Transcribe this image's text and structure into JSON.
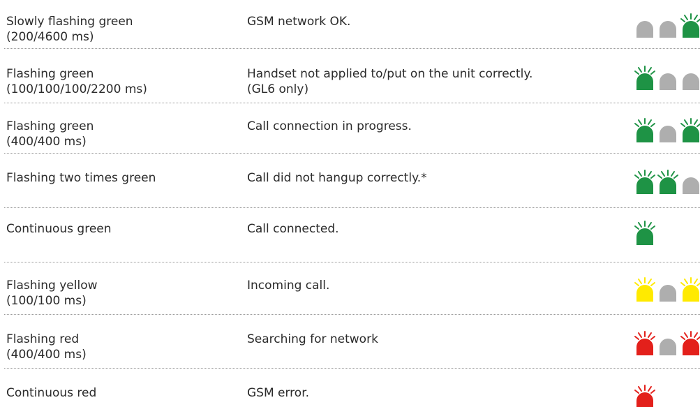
{
  "colors": {
    "green": "#1e9345",
    "gray": "#aeaeae",
    "yellow": "#ffea00",
    "red": "#e3201b",
    "separator": "#9a9a9a",
    "text": "#2b2b2b"
  },
  "rows": [
    {
      "state": [
        "Slowly flashing green",
        "(200/4600 ms)"
      ],
      "meaning": [
        "GSM network OK."
      ],
      "leds": [
        {
          "color": "gray",
          "rays": false
        },
        {
          "color": "gray",
          "rays": false
        },
        {
          "color": "green",
          "rays": true
        }
      ]
    },
    {
      "state": [
        "Flashing green",
        "(100/100/100/2200 ms)"
      ],
      "meaning": [
        "Handset not applied to/put on the unit correctly.",
        "(GL6 only)"
      ],
      "leds": [
        {
          "color": "green",
          "rays": true
        },
        {
          "color": "gray",
          "rays": false
        },
        {
          "color": "gray",
          "rays": false
        }
      ]
    },
    {
      "state": [
        "Flashing green",
        "(400/400 ms)"
      ],
      "meaning": [
        "Call connection in progress."
      ],
      "leds": [
        {
          "color": "green",
          "rays": true
        },
        {
          "color": "gray",
          "rays": false
        },
        {
          "color": "green",
          "rays": true
        }
      ]
    },
    {
      "state": [
        "Flashing two times green"
      ],
      "meaning": [
        "Call did not hangup correctly.*"
      ],
      "leds": [
        {
          "color": "green",
          "rays": true
        },
        {
          "color": "green",
          "rays": true
        },
        {
          "color": "gray",
          "rays": false
        }
      ]
    },
    {
      "state": [
        "Continuous green"
      ],
      "meaning": [
        "Call connected."
      ],
      "leds": [
        {
          "color": "green",
          "rays": true
        }
      ]
    },
    {
      "state": [
        "Flashing yellow",
        "(100/100 ms)"
      ],
      "meaning": [
        "Incoming call."
      ],
      "leds": [
        {
          "color": "yellow",
          "rays": true
        },
        {
          "color": "gray",
          "rays": false
        },
        {
          "color": "yellow",
          "rays": true
        }
      ]
    },
    {
      "state": [
        "Flashing red",
        "(400/400 ms)"
      ],
      "meaning": [
        "Searching for network"
      ],
      "leds": [
        {
          "color": "red",
          "rays": true
        },
        {
          "color": "gray",
          "rays": false
        },
        {
          "color": "red",
          "rays": true
        }
      ]
    },
    {
      "state": [
        "Continuous red"
      ],
      "meaning": [
        "GSM error."
      ],
      "leds": [
        {
          "color": "red",
          "rays": true
        }
      ]
    }
  ]
}
